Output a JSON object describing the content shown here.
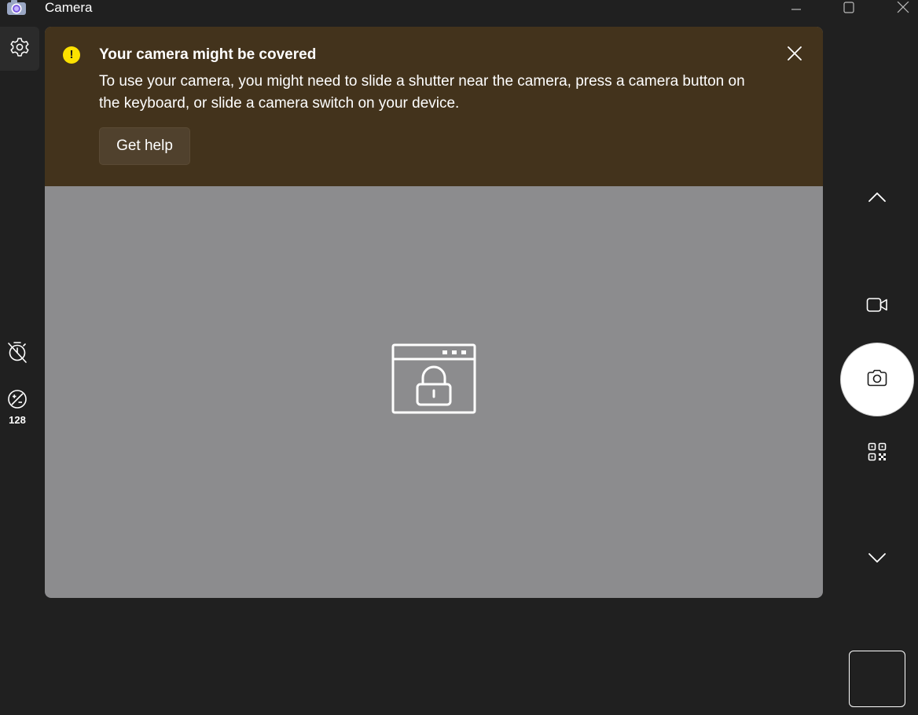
{
  "window": {
    "title": "Camera",
    "app_icon": "camera-app-icon",
    "controls": [
      "minimize-icon",
      "maximize-icon",
      "close-icon"
    ]
  },
  "left_toolbar": {
    "settings_icon": "gear-icon",
    "timer_icon": "timer-off-icon",
    "exposure_icon": "exposure-icon",
    "exposure_value": "128"
  },
  "notification": {
    "icon": "warning-icon",
    "icon_glyph": "!",
    "title": "Your camera might be covered",
    "message": "To use your camera, you might need to slide a shutter near the camera, press a camera button on the keyboard, or slide a camera switch on your device.",
    "button_label": "Get help",
    "close_icon": "close-icon"
  },
  "preview": {
    "state_icon": "locked-window-icon"
  },
  "right_toolbar": {
    "items": [
      "chevron-up-icon",
      "video-camera-icon",
      "camera-icon",
      "qr-code-icon",
      "chevron-down-icon"
    ],
    "selected_mode": "photo"
  },
  "colors": {
    "background": "#202020",
    "banner": "#43331c",
    "preview": "#8c8c8e",
    "warning": "#fce100"
  }
}
